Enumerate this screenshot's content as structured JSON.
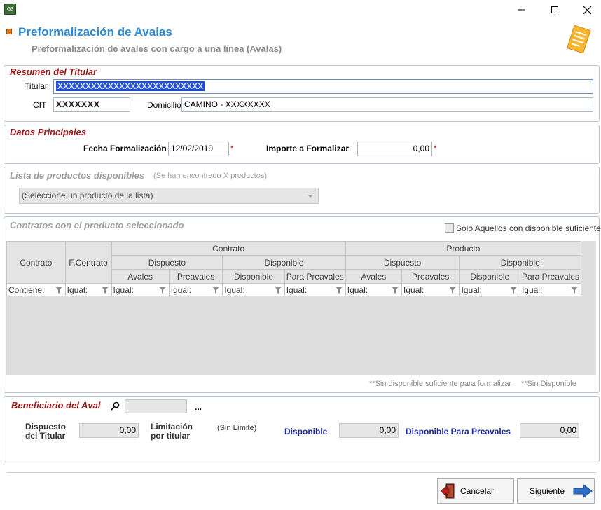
{
  "window": {
    "app_icon_text": "G3",
    "minimize_icon": "minimize-icon",
    "maximize_icon": "maximize-icon",
    "close_icon": "close-icon"
  },
  "header": {
    "title": "Preformalización de Avalas",
    "subtitle": "Preformalización de avales con cargo a una línea (Avalas)"
  },
  "resumen": {
    "title": "Resumen del Titular",
    "titular_label": "Titular",
    "titular_value": "XXXXXXXXXXXXXXXXXXXXXXXXXX",
    "cit_label": "CIT",
    "cit_value": "XXXXXXX",
    "domicilio_label": "Domicilio",
    "domicilio_value": "CAMINO - XXXXXXXX"
  },
  "datos": {
    "title": "Datos Principales",
    "fecha_label": "Fecha Formalización",
    "fecha_value": "12/02/2019",
    "importe_label": "Importe a Formalizar",
    "importe_value": "0,00",
    "required_mark": "*"
  },
  "productos": {
    "title": "Lista de productos disponibles",
    "count_note": "(Se han encontrado X productos)",
    "select_value": "(Seleccione un producto de la lista)"
  },
  "contratos": {
    "title": "Contratos con el producto seleccionado",
    "checkbox_label": "Solo Aquellos con disponible suficiente",
    "group_contrato": "Contrato",
    "group_producto": "Producto",
    "col_contrato": "Contrato",
    "col_fcontrato": "F.Contrato",
    "sub_dispuesto": "Dispuesto",
    "sub_disponible": "Disponible",
    "leaf_headers": [
      "Avales",
      "Preavales",
      "Disponible",
      "Para Preavales",
      "Avales",
      "Preavales",
      "Disponible",
      "Para Preavales"
    ],
    "filters": [
      "Contiene:",
      "Igual:",
      "Igual:",
      "Igual:",
      "Igual:",
      "Igual:",
      "Igual:",
      "Igual:",
      "Igual:",
      "Igual:"
    ],
    "note1": "**Sin disponible suficiente para formalizar",
    "note2": "**Sin Disponible"
  },
  "beneficiario": {
    "title": "Beneficiario del Aval",
    "search_icon": "magnifier-icon",
    "ellipsis": "...",
    "dispuesto_label_1": "Dispuesto",
    "dispuesto_label_2": "del Titular",
    "dispuesto_value": "0,00",
    "limitacion_label_1": "Limitación",
    "limitacion_label_2": "por titular",
    "limitacion_value": "(Sin Límite)",
    "disponible_label": "Disponible",
    "disponible_value": "0,00",
    "disp_preavales_label": "Disponible Para Preavales",
    "disp_preavales_value": "0,00"
  },
  "buttons": {
    "cancelar": "Cancelar",
    "siguiente": "Siguiente"
  },
  "colors": {
    "title_blue": "#2b8ad6",
    "section_red": "#9a1b1b",
    "label_blue": "#1a2aa0"
  }
}
